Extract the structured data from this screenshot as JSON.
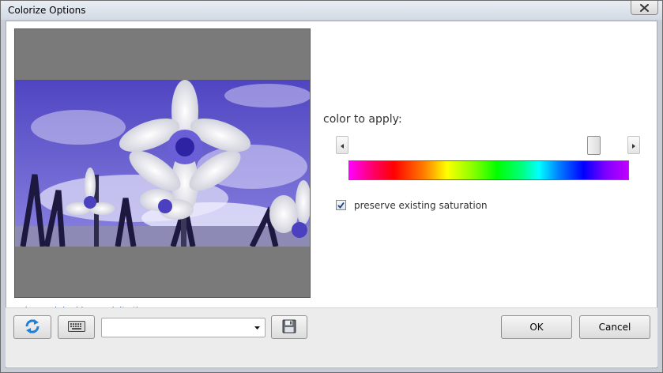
{
  "window": {
    "title": "Colorize Options"
  },
  "preview": {
    "show_original_link": "show original image (alt+t)"
  },
  "colorize": {
    "label": "color to apply:",
    "hue_slider_level": 0.9,
    "preserve_saturation_label": "preserve existing saturation",
    "preserve_saturation_checked": true
  },
  "footer": {
    "preset_value": "",
    "ok_label": "OK",
    "cancel_label": "Cancel"
  },
  "icons": {
    "close": "close-icon",
    "refresh": "refresh-icon",
    "keyboard": "keyboard-icon",
    "save": "floppy-disk-icon",
    "dropdown": "chevron-down-icon",
    "scroll_left": "arrow-left-icon",
    "scroll_right": "arrow-right-icon",
    "check": "checkmark-icon"
  },
  "colors": {
    "tint": "#5a4fc8",
    "window_frame": "#c9ced6",
    "link": "#2a5da8"
  }
}
